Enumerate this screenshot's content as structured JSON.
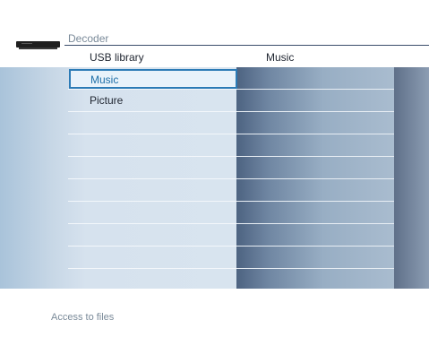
{
  "header": {
    "breadcrumb": "Decoder",
    "col1_title": "USB library",
    "col2_title": "Music"
  },
  "menu": {
    "items": [
      {
        "label": "Music",
        "selected": true
      },
      {
        "label": "Picture",
        "selected": false
      }
    ]
  },
  "footer": {
    "status": "Access to files"
  },
  "icons": {
    "device": "decoder-device-icon"
  },
  "colors": {
    "accent": "#2c7bb6",
    "selected_text": "#1e6fa8"
  }
}
